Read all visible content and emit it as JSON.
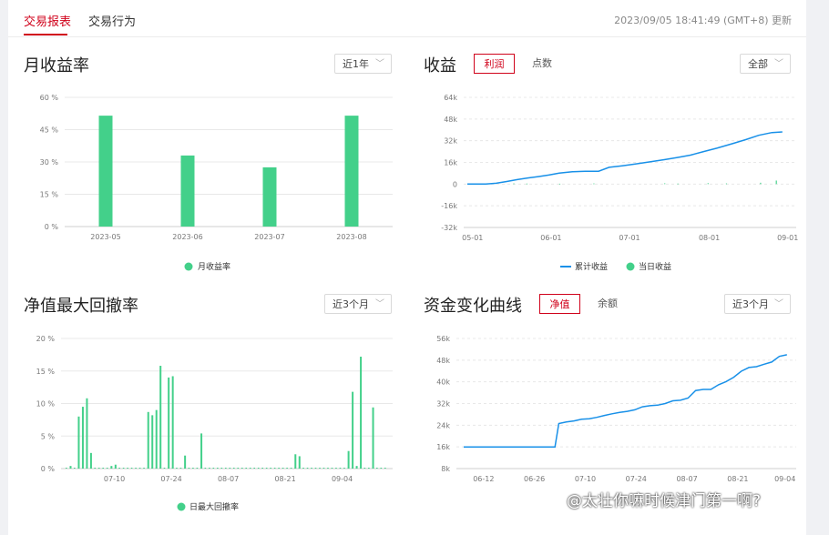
{
  "tabs": [
    {
      "label": "交易报表",
      "active": true
    },
    {
      "label": "交易行为",
      "active": false
    }
  ],
  "update_time": "2023/09/05 18:41:49 (GMT+8) 更新",
  "colors": {
    "accent": "#d0021b",
    "green": "#43d08a",
    "blue": "#1890e8"
  },
  "panels": {
    "monthly": {
      "title": "月收益率",
      "dropdown": "近1年"
    },
    "profit": {
      "title": "收益",
      "toggle_on": "利润",
      "toggle_off": "点数",
      "dropdown": "全部"
    },
    "drawdown": {
      "title": "净值最大回撤率",
      "dropdown": "近3个月"
    },
    "capital": {
      "title": "资金变化曲线",
      "toggle_on": "净值",
      "toggle_off": "余额",
      "dropdown": "近3个月"
    }
  },
  "chart_data": [
    {
      "id": "monthly",
      "type": "bar",
      "categories": [
        "2023-05",
        "2023-06",
        "2023-07",
        "2023-08"
      ],
      "y_ticks": [
        "60 %",
        "45 %",
        "30 %",
        "15 %",
        "0 %"
      ],
      "ylim": [
        0,
        60
      ],
      "series": [
        {
          "name": "月收益率",
          "values": [
            51.5,
            33,
            27.5,
            51.5
          ]
        }
      ],
      "legend": "bottom"
    },
    {
      "id": "profit",
      "type": "line",
      "x_ticks": [
        "05-01",
        "06-01",
        "07-01",
        "08-01",
        "09-01"
      ],
      "y_ticks": [
        "64k",
        "48k",
        "32k",
        "16k",
        "0",
        "-16k",
        "-32k"
      ],
      "ylim": [
        -32000,
        64000
      ],
      "series": [
        {
          "name": "累计收益",
          "type": "line",
          "points": [
            [
              0,
              0
            ],
            [
              14,
              0
            ],
            [
              22,
              600
            ],
            [
              30,
              1900
            ],
            [
              38,
              3300
            ],
            [
              46,
              4500
            ],
            [
              54,
              5500
            ],
            [
              62,
              6700
            ],
            [
              70,
              8100
            ],
            [
              80,
              9100
            ],
            [
              90,
              9500
            ],
            [
              100,
              9500
            ],
            [
              108,
              12400
            ],
            [
              118,
              13500
            ],
            [
              128,
              14800
            ],
            [
              138,
              16300
            ],
            [
              150,
              18000
            ],
            [
              160,
              19600
            ],
            [
              170,
              21400
            ],
            [
              180,
              24000
            ],
            [
              190,
              26500
            ],
            [
              202,
              29800
            ],
            [
              212,
              32800
            ],
            [
              222,
              36000
            ],
            [
              232,
              38000
            ],
            [
              240,
              38500
            ]
          ]
        },
        {
          "name": "当日收益",
          "type": "bar",
          "points": [
            [
              35,
              500
            ],
            [
              45,
              400
            ],
            [
              70,
              300
            ],
            [
              96,
              500
            ],
            [
              150,
              600
            ],
            [
              160,
              400
            ],
            [
              183,
              700
            ],
            [
              197,
              500
            ],
            [
              223,
              1000
            ],
            [
              235,
              2600
            ]
          ]
        }
      ],
      "legend": "bottom"
    },
    {
      "id": "drawdown",
      "type": "bar",
      "x_ticks": [
        "07-10",
        "07-24",
        "08-07",
        "08-21",
        "09-04"
      ],
      "y_ticks": [
        "20 %",
        "15 %",
        "10 %",
        "5 %",
        "0 %"
      ],
      "ylim": [
        0,
        20
      ],
      "series": [
        {
          "name": "日最大回撤率",
          "points": [
            [
              1,
              0.4
            ],
            [
              3,
              8
            ],
            [
              4,
              9.5
            ],
            [
              5,
              10.8
            ],
            [
              6,
              2.4
            ],
            [
              11,
              0.4
            ],
            [
              12,
              0.6
            ],
            [
              20,
              8.7
            ],
            [
              21,
              8.2
            ],
            [
              22,
              9
            ],
            [
              23,
              15.8
            ],
            [
              25,
              14
            ],
            [
              26,
              14.2
            ],
            [
              29,
              2
            ],
            [
              33,
              5.4
            ],
            [
              56,
              2.2
            ],
            [
              57,
              1.9
            ],
            [
              69,
              2.7
            ],
            [
              70,
              11.8
            ],
            [
              71,
              0.4
            ],
            [
              72,
              17.2
            ],
            [
              75,
              9.4
            ]
          ]
        }
      ],
      "legend": "bottom"
    },
    {
      "id": "capital",
      "type": "line",
      "x_ticks": [
        "06-12",
        "06-26",
        "07-10",
        "07-24",
        "08-07",
        "08-21",
        "09-04"
      ],
      "y_ticks": [
        "56k",
        "48k",
        "40k",
        "32k",
        "24k",
        "16k",
        "8k"
      ],
      "ylim": [
        8000,
        56000
      ],
      "series": [
        {
          "name": "净值",
          "points": [
            [
              0,
              16000
            ],
            [
              24,
              16000
            ],
            [
              25,
              24600
            ],
            [
              27,
              25200
            ],
            [
              29,
              25600
            ],
            [
              31,
              26200
            ],
            [
              33,
              26400
            ],
            [
              35,
              26900
            ],
            [
              37,
              27600
            ],
            [
              39,
              28200
            ],
            [
              41,
              28700
            ],
            [
              43,
              29100
            ],
            [
              45,
              29700
            ],
            [
              47,
              30800
            ],
            [
              49,
              31200
            ],
            [
              51,
              31400
            ],
            [
              53,
              32000
            ],
            [
              55,
              33000
            ],
            [
              57,
              33200
            ],
            [
              59,
              34000
            ],
            [
              61,
              36800
            ],
            [
              63,
              37200
            ],
            [
              65,
              37200
            ],
            [
              67,
              38900
            ],
            [
              69,
              40100
            ],
            [
              71,
              41700
            ],
            [
              73,
              43900
            ],
            [
              75,
              45300
            ],
            [
              77,
              45600
            ],
            [
              79,
              46500
            ],
            [
              81,
              47300
            ],
            [
              83,
              49400
            ],
            [
              85,
              50000
            ]
          ]
        }
      ],
      "legend": "none"
    }
  ],
  "watermark": "@太壮你嘛时候津门第一啊?"
}
